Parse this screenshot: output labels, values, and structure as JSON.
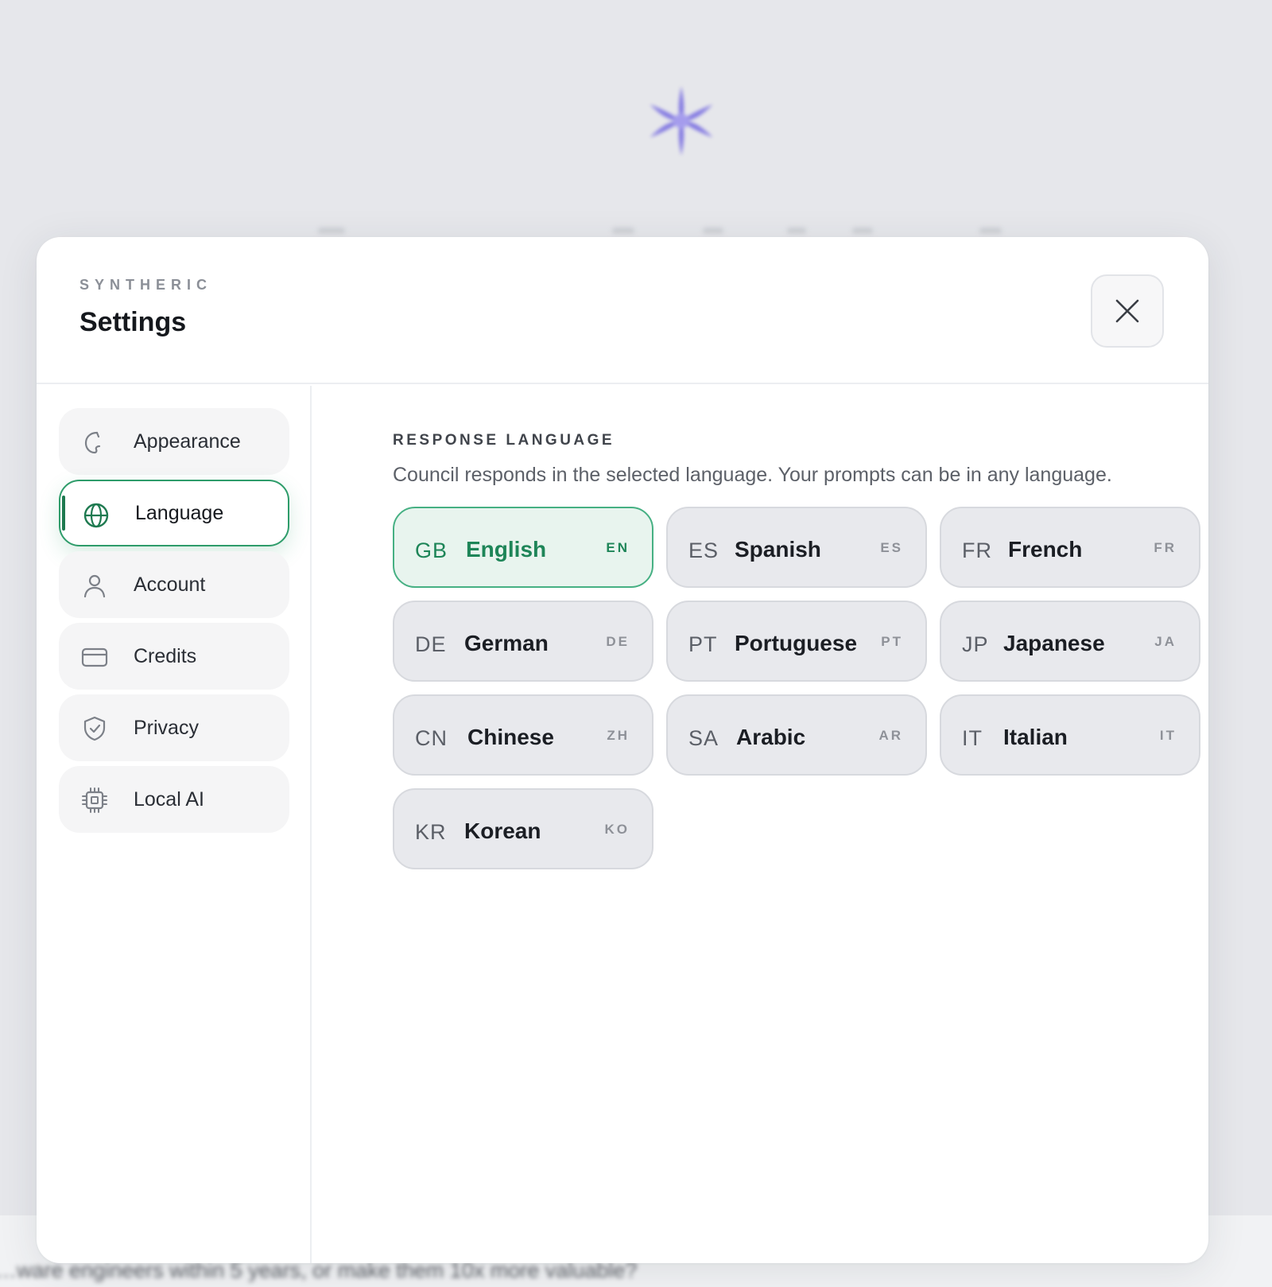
{
  "background": {
    "footer_text": "…ware engineers within 5 years, or make them 10x more valuable?"
  },
  "modal": {
    "brand": "SYNTHERIC",
    "title": "Settings",
    "close_icon": "close-icon"
  },
  "sidebar": {
    "items": [
      {
        "label": "Appearance",
        "icon": "palette-icon"
      },
      {
        "label": "Language",
        "icon": "globe-icon",
        "active": true
      },
      {
        "label": "Account",
        "icon": "user-icon"
      },
      {
        "label": "Credits",
        "icon": "credit-card-icon"
      },
      {
        "label": "Privacy",
        "icon": "shield-check-icon"
      },
      {
        "label": "Local AI",
        "icon": "chip-icon"
      }
    ]
  },
  "language": {
    "section_title": "RESPONSE LANGUAGE",
    "description": "Council responds in the selected language. Your prompts can be in any language.",
    "selected": "EN",
    "options": [
      {
        "flag": "GB",
        "name": "English",
        "code": "EN"
      },
      {
        "flag": "ES",
        "name": "Spanish",
        "code": "ES"
      },
      {
        "flag": "FR",
        "name": "French",
        "code": "FR"
      },
      {
        "flag": "DE",
        "name": "German",
        "code": "DE"
      },
      {
        "flag": "PT",
        "name": "Portuguese",
        "code": "PT"
      },
      {
        "flag": "JP",
        "name": "Japanese",
        "code": "JA"
      },
      {
        "flag": "CN",
        "name": "Chinese",
        "code": "ZH"
      },
      {
        "flag": "SA",
        "name": "Arabic",
        "code": "AR"
      },
      {
        "flag": "IT",
        "name": "Italian",
        "code": "IT"
      },
      {
        "flag": "KR",
        "name": "Korean",
        "code": "KO"
      }
    ]
  },
  "colors": {
    "accent": "#1e8558",
    "accent_border": "#46b083",
    "selected_bg": "#e8f4ee",
    "logo": "#7a6ee6"
  }
}
